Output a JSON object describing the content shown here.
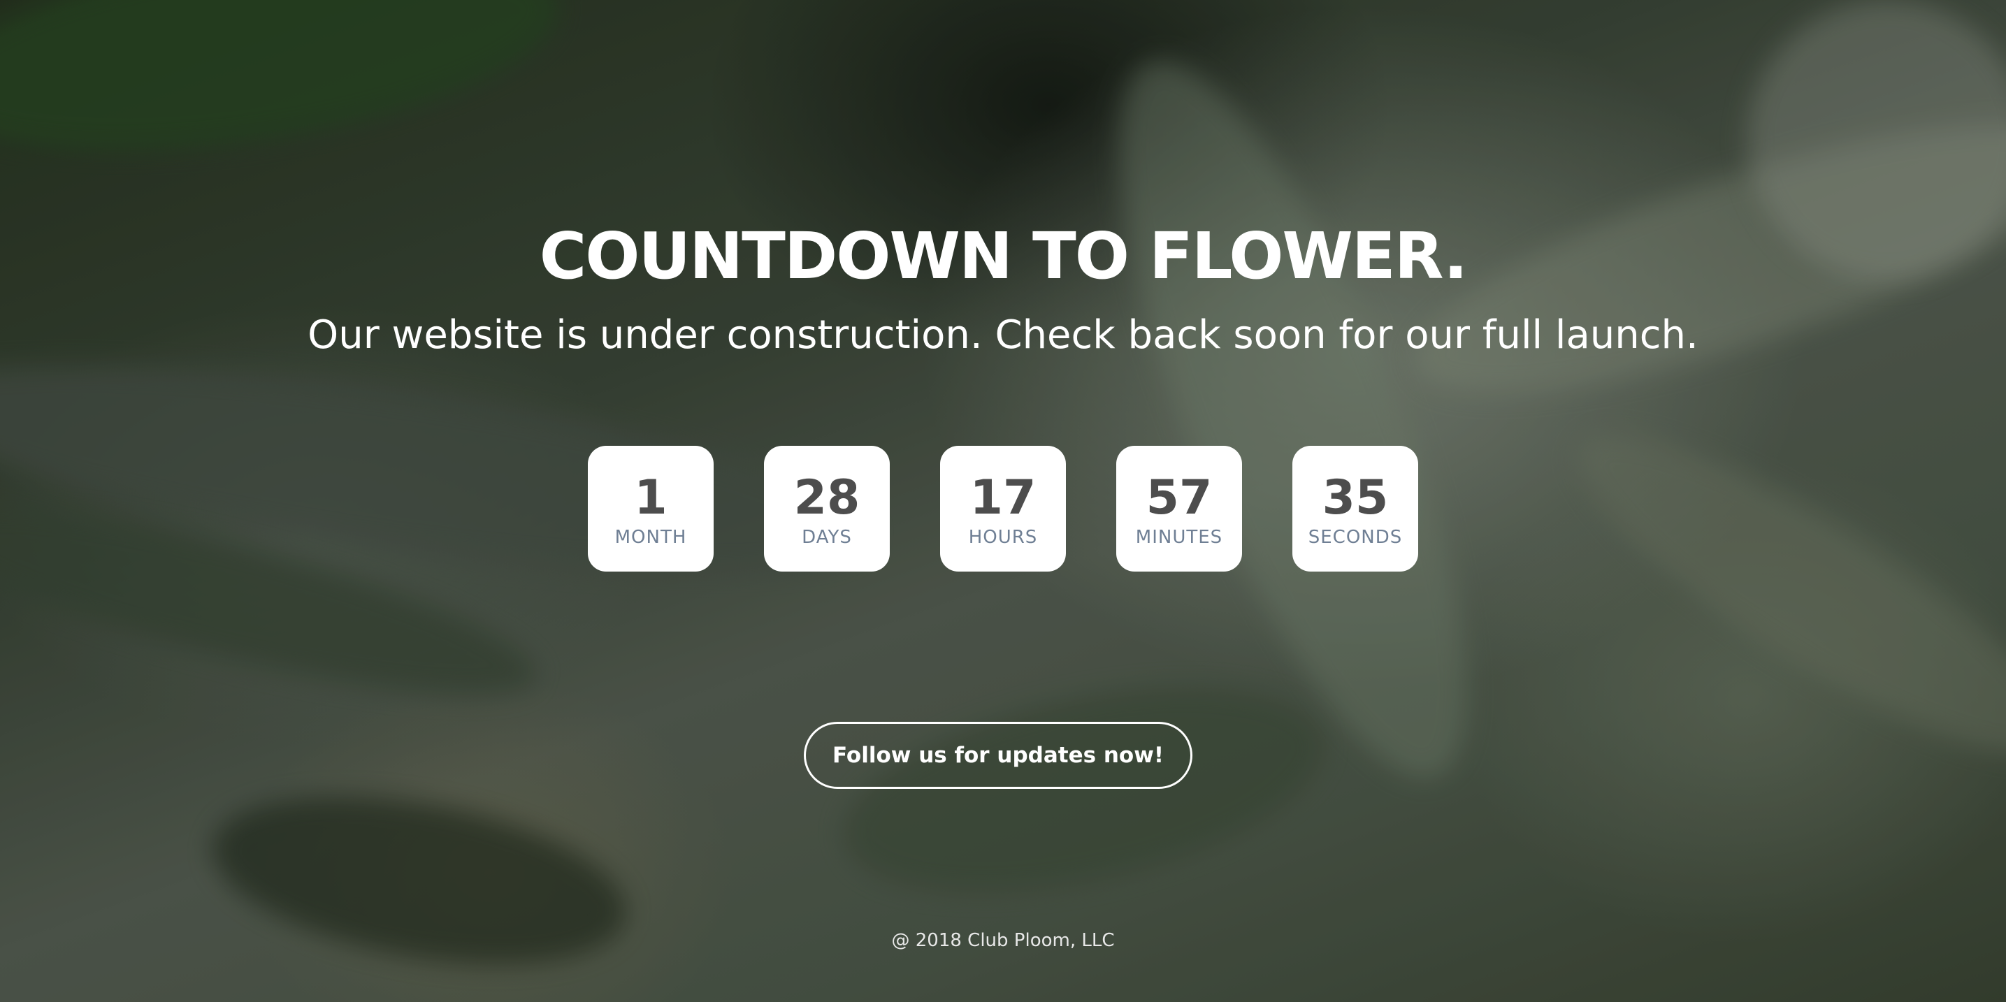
{
  "page": {
    "title": "COUNTDOWN TO FLOWER.",
    "subtitle": "Our website is under construction. Check back soon for our full launch."
  },
  "countdown": [
    {
      "value": "1",
      "label": "MONTH"
    },
    {
      "value": "28",
      "label": "DAYS"
    },
    {
      "value": "17",
      "label": "HOURS"
    },
    {
      "value": "57",
      "label": "MINUTES"
    },
    {
      "value": "35",
      "label": "SECONDS"
    }
  ],
  "cta": {
    "label": "Follow us for updates now!"
  },
  "footer": {
    "copyright": "@ 2018 Club Ploom, LLC"
  },
  "colors": {
    "text": "#ffffff",
    "tile_background": "#ffffff",
    "tile_number": "#4d4d4d",
    "tile_label": "#6f7f94"
  }
}
